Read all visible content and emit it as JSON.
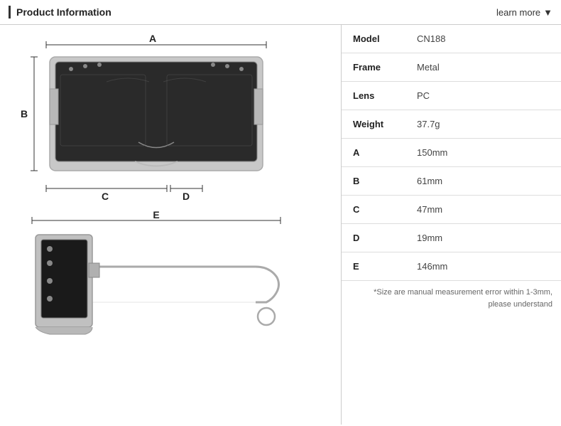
{
  "header": {
    "title": "Product Information",
    "learn_more": "learn more",
    "arrow": "▼"
  },
  "specs": [
    {
      "label": "Model",
      "value": "CN188"
    },
    {
      "label": "Frame",
      "value": "Metal"
    },
    {
      "label": "Lens",
      "value": "PC"
    },
    {
      "label": "Weight",
      "value": "37.7g"
    },
    {
      "label": "A",
      "value": "150mm"
    },
    {
      "label": "B",
      "value": "61mm"
    },
    {
      "label": "C",
      "value": "47mm"
    },
    {
      "label": "D",
      "value": "19mm"
    },
    {
      "label": "E",
      "value": "146mm"
    }
  ],
  "note": "*Size are manual measurement error within 1-3mm, please understand",
  "diagram": {
    "labels": [
      "A",
      "B",
      "C",
      "D",
      "E"
    ]
  }
}
